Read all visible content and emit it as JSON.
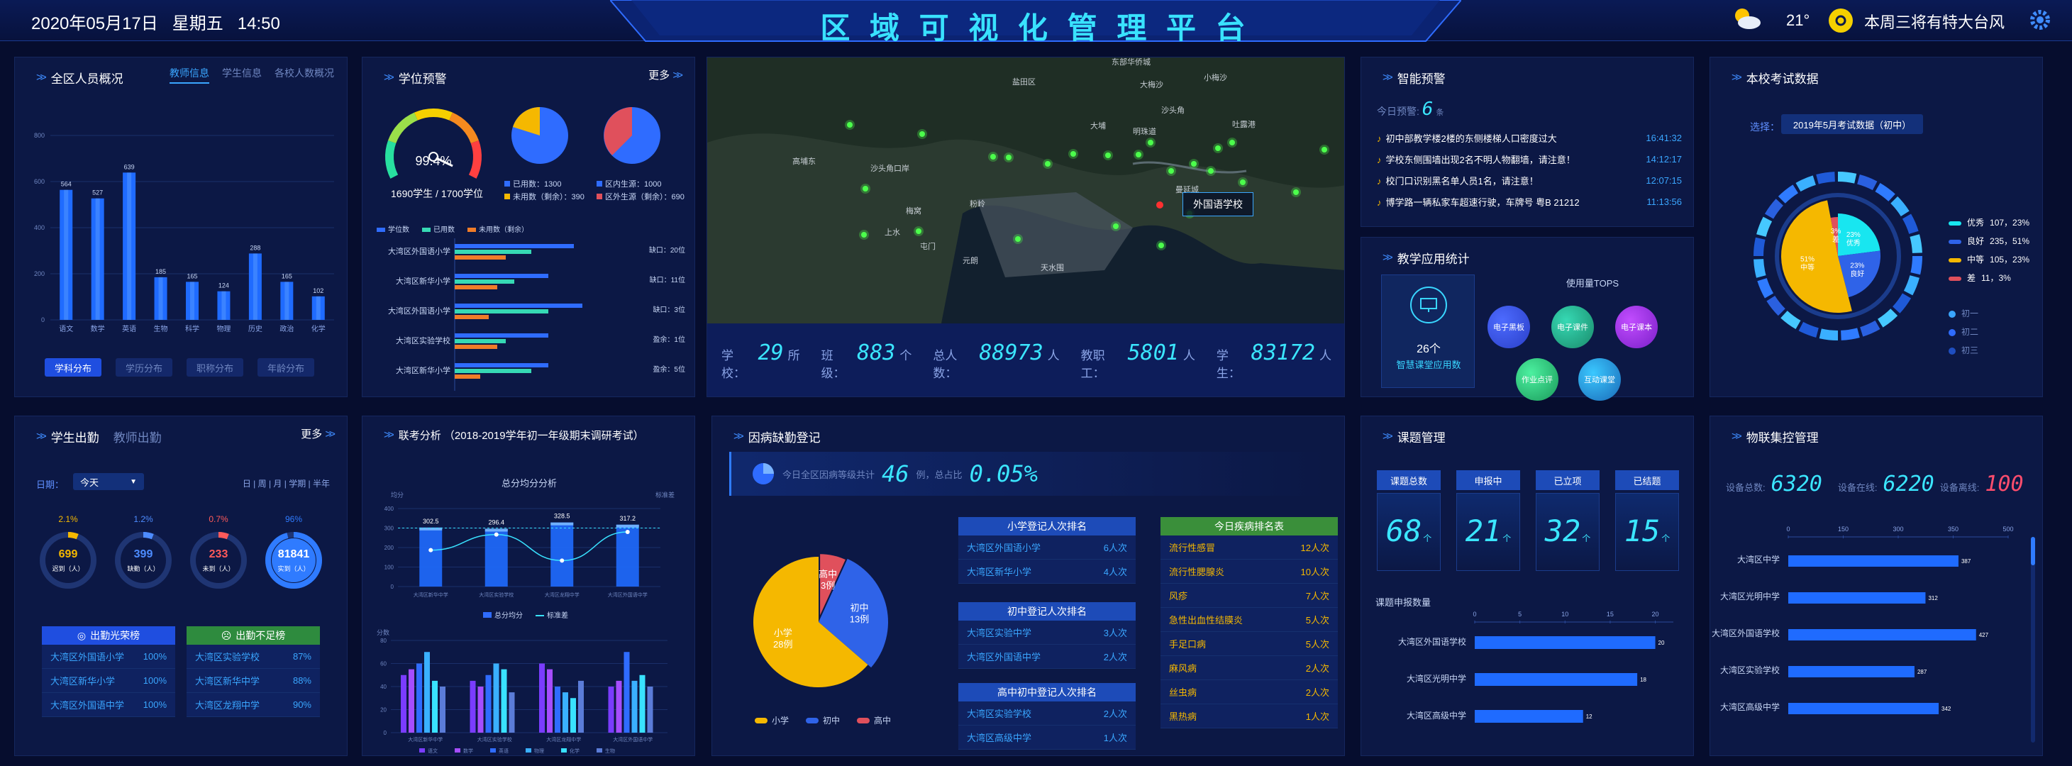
{
  "header": {
    "datetime": "2020年05月17日   星期五   14:50",
    "title": "区 域 可 视 化 管 理 平 台",
    "temperature": "21°",
    "weather_note": "本周三将有特大台风"
  },
  "personnel": {
    "title": "全区人员概况",
    "tabs": [
      "教师信息",
      "学生信息",
      "各校人数概况"
    ],
    "y_ticks": [
      "800",
      "600",
      "400",
      "200",
      "0"
    ],
    "bottom_tabs": [
      "学科分布",
      "学历分布",
      "职称分布",
      "年龄分布"
    ],
    "chart_data": {
      "type": "bar",
      "categories": [
        "语文",
        "数学",
        "英语",
        "生物",
        "科学",
        "物理",
        "历史",
        "政治",
        "化学"
      ],
      "values": [
        564,
        527,
        639,
        185,
        165,
        124,
        288,
        165,
        102
      ],
      "ylim": [
        0,
        800
      ]
    }
  },
  "enrollment": {
    "title": "学位预警",
    "more": "更多",
    "gauge_value": "99.4%",
    "gauge_fraction": 0.994,
    "gauge_caption": "1690学生 / 1700学位",
    "pie1_legend": [
      "已用数：1300",
      "未用数（剩余）：390"
    ],
    "pie2_legend": [
      "区内生源：1000",
      "区外生源（剩余）：690"
    ],
    "bar_legend": [
      "学位数",
      "已用数",
      "未用数（剩余）"
    ],
    "chart_data": {
      "type": "bar",
      "categories": [
        "大湾区外国语小学",
        "大湾区新华小学",
        "大湾区外国语小学",
        "大湾区实验学校",
        "大湾区新华小学"
      ],
      "series": [
        {
          "name": "学位数",
          "values": [
            0.7,
            0.55,
            0.75,
            0.55,
            0.55
          ]
        },
        {
          "name": "已用数",
          "values": [
            0.45,
            0.35,
            0.55,
            0.3,
            0.45
          ]
        },
        {
          "name": "未用数（剩余）",
          "values": [
            0.3,
            0.25,
            0.2,
            0.25,
            0.15
          ]
        }
      ]
    },
    "row_notes": [
      "缺口：20位",
      "缺口：11位",
      "缺口：3位",
      "盈余：1位",
      "盈余：5位"
    ]
  },
  "map": {
    "popup": "外国语学校",
    "stats": [
      {
        "label": "学校：",
        "value": "29",
        "unit": "所"
      },
      {
        "label": "班级：",
        "value": "883",
        "unit": "个"
      },
      {
        "label": "总人数：",
        "value": "88973",
        "unit": "人"
      },
      {
        "label": "教职工：",
        "value": "5801",
        "unit": "人"
      },
      {
        "label": "学生：",
        "value": "83172",
        "unit": "人"
      }
    ],
    "place_labels": [
      "东部华侨城",
      "盐田区",
      "大梅沙",
      "小梅沙",
      "沙头角",
      "明珠道",
      "高埔东",
      "沙头角口岸",
      "大埔",
      "吐露港",
      "曼延城",
      "梅窝",
      "粉岭",
      "上水",
      "屯门",
      "元朗",
      "天水围"
    ]
  },
  "alerts": {
    "title": "智能预警",
    "today_label": "今日预警:",
    "today_count": "6",
    "today_unit": "条",
    "items": [
      {
        "text": "初中部教学楼2楼的东侧楼梯人口密度过大",
        "time": "16:41:32"
      },
      {
        "text": "学校东侧围墙出现2名不明人物翻墙，请注意！",
        "time": "14:12:17"
      },
      {
        "text": "校门口识别黑名单人员1名，请注意！",
        "time": "12:07:15"
      },
      {
        "text": "博学路一辆私家车超速行驶，车牌号 粤B 21212",
        "time": "11:13:56"
      }
    ]
  },
  "teaching": {
    "title": "教学应用统计",
    "count": "26个",
    "caption": "智慧课堂应用数",
    "tops_title": "使用量TOPS",
    "bubbles": [
      "电子黑板",
      "电子课件",
      "电子课本",
      "作业点评",
      "互动课堂"
    ]
  },
  "exam": {
    "title": "本校考试数据",
    "select_label": "选择：",
    "select_value": "2019年5月考试数据（初中）",
    "legend": [
      {
        "label": "优秀",
        "value": "107，23%",
        "color": "#18e6f0"
      },
      {
        "label": "良好",
        "value": "235，51%",
        "color": "#2f63e8"
      },
      {
        "label": "中等",
        "value": "105，23%",
        "color": "#f5b800"
      },
      {
        "label": "差",
        "value": "11，3%",
        "color": "#e0505c"
      }
    ],
    "grade_legend": [
      "初一",
      "初二",
      "初三"
    ],
    "chart_data": {
      "type": "pie",
      "categories": [
        "优秀",
        "良好",
        "中等",
        "差"
      ],
      "values": [
        23,
        23,
        51,
        3
      ],
      "labels": [
        "23%优秀",
        "23%良好",
        "51%中等",
        "3%差"
      ]
    }
  },
  "attendance": {
    "title": "学生出勤",
    "tab2": "教师出勤",
    "more": "更多",
    "date_label": "日期：",
    "date_value": "今天",
    "period_tabs": "日 | 周 | 月 | 学期 | 半年",
    "rings": [
      {
        "pct": "2.1%",
        "value": "699",
        "label": "迟到（人）",
        "color": "#f5b800",
        "frac": 0.021
      },
      {
        "pct": "1.2%",
        "value": "399",
        "label": "缺勤（人）",
        "color": "#4d8cff",
        "frac": 0.012
      },
      {
        "pct": "0.7%",
        "value": "233",
        "label": "未到（人）",
        "color": "#ff5a5a",
        "frac": 0.007
      },
      {
        "pct": "96%",
        "value": "81841",
        "label": "实到（人）",
        "color": "#2f7bff",
        "frac": 0.96
      }
    ],
    "good_title": "出勤光荣榜",
    "bad_title": "出勤不足榜",
    "good": [
      [
        "大湾区外国语小学",
        "100%"
      ],
      [
        "大湾区新华小学",
        "100%"
      ],
      [
        "大湾区外国语中学",
        "100%"
      ]
    ],
    "bad": [
      [
        "大湾区实验学校",
        "87%"
      ],
      [
        "大湾区新华中学",
        "88%"
      ],
      [
        "大湾区龙翔中学",
        "90%"
      ]
    ]
  },
  "joint_exam": {
    "title": "联考分析 （2018-2019学年初一年级期末调研考试）",
    "subtitle": "总分均分分析",
    "y_label_left": "均分",
    "y_label_right": "标准差",
    "legend": [
      "总分均分",
      "标准差"
    ],
    "bottom_y_label": "分数",
    "chart_data": [
      {
        "type": "bar",
        "categories": [
          "大湾区新华中学",
          "大湾区实验学校",
          "大湾区龙翔中学",
          "大湾区外国语中学"
        ],
        "series": [
          {
            "name": "总分均分",
            "values": [
              302.5,
              296.4,
              328.5,
              317.2
            ]
          },
          {
            "name": "标准差",
            "values": [
              28,
              40,
              20,
              42
            ]
          }
        ],
        "ylim": [
          0,
          400
        ]
      },
      {
        "type": "bar",
        "categories": [
          "大湾区新华中学",
          "大湾区实验学校",
          "大湾区龙翔中学",
          "大湾区外国语中学"
        ],
        "series": [
          {
            "name": "语文",
            "values": [
              50,
              45,
              60,
              40
            ]
          },
          {
            "name": "数学",
            "values": [
              55,
              40,
              55,
              45
            ]
          },
          {
            "name": "英语",
            "values": [
              60,
              50,
              40,
              70
            ]
          },
          {
            "name": "物理",
            "values": [
              70,
              60,
              35,
              45
            ]
          },
          {
            "name": "化学",
            "values": [
              45,
              55,
              30,
              50
            ]
          },
          {
            "name": "生物",
            "values": [
              40,
              35,
              45,
              40
            ]
          }
        ],
        "ylim": [
          0,
          80
        ]
      }
    ],
    "bottom_y_ticks": [
      "80",
      "60",
      "40",
      "20",
      "0"
    ],
    "top_y_ticks": [
      "400",
      "300",
      "200",
      "100",
      "0"
    ]
  },
  "illness": {
    "title": "因病缺勤登记",
    "summary_label": "今日全区因病等级共计",
    "summary_count": "46",
    "summary_unit": "例，总占比",
    "summary_pct": "0.05%",
    "chart_data": {
      "type": "pie",
      "categories": [
        "小学",
        "初中",
        "高中"
      ],
      "values": [
        28,
        13,
        3
      ],
      "labels": [
        "小学\n28例",
        "初中\n13例",
        "高中\n3例"
      ]
    },
    "legend": [
      "小学",
      "初中",
      "高中"
    ],
    "primary_title": "小学登记人次排名",
    "primary": [
      [
        "大湾区外国语小学",
        "6人次"
      ],
      [
        "大湾区新华小学",
        "4人次"
      ]
    ],
    "middle_title": "初中登记人次排名",
    "middle": [
      [
        "大湾区实验中学",
        "3人次"
      ],
      [
        "大湾区外国语中学",
        "2人次"
      ]
    ],
    "high_title": "高中初中登记人次排名",
    "high": [
      [
        "大湾区实验学校",
        "2人次"
      ],
      [
        "大湾区高级中学",
        "1人次"
      ]
    ],
    "disease_title": "今日疾病排名表",
    "diseases": [
      [
        "流行性感冒",
        "12人次"
      ],
      [
        "流行性腮腺炎",
        "10人次"
      ],
      [
        "风疹",
        "7人次"
      ],
      [
        "急性出血性结膜炎",
        "5人次"
      ],
      [
        "手足口病",
        "5人次"
      ],
      [
        "麻风病",
        "2人次"
      ],
      [
        "丝虫病",
        "2人次"
      ],
      [
        "黑热病",
        "1人次"
      ]
    ]
  },
  "projects": {
    "title": "课题管理",
    "cards": [
      {
        "label": "课题总数",
        "value": "68",
        "unit": "个"
      },
      {
        "label": "申报中",
        "value": "21",
        "unit": "个"
      },
      {
        "label": "已立项",
        "value": "32",
        "unit": "个"
      },
      {
        "label": "已结题",
        "value": "15",
        "unit": "个"
      }
    ],
    "chart_title": "课题申报数量",
    "x_ticks": [
      "0",
      "5",
      "10",
      "15",
      "20"
    ],
    "chart_data": {
      "type": "bar",
      "categories": [
        "大湾区外国语学校",
        "大湾区光明中学",
        "大湾区高级中学"
      ],
      "values": [
        20,
        18,
        12
      ],
      "xlim": [
        0,
        22
      ]
    }
  },
  "iot": {
    "title": "物联集控管理",
    "total_label": "设备总数:",
    "total": "6320",
    "online_label": "设备在线:",
    "online": "6220",
    "offline_label": "设备离线:",
    "offline": "100",
    "x_ticks": [
      "0",
      "150",
      "300",
      "350",
      "500"
    ],
    "chart_data": {
      "type": "bar",
      "categories": [
        "大湾区中学",
        "大湾区光明中学",
        "大湾区外国语学校",
        "大湾区实验学校",
        "大湾区高级中学"
      ],
      "values": [
        387,
        312,
        427,
        287,
        342
      ],
      "xlim": [
        0,
        500
      ]
    }
  }
}
